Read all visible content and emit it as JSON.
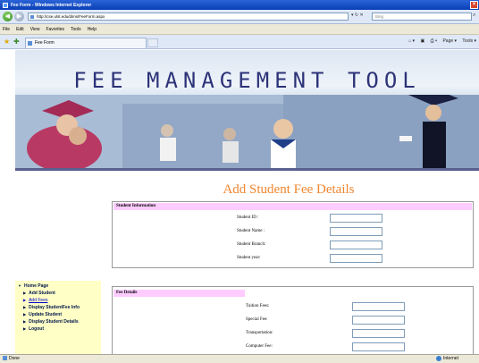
{
  "browser": {
    "window_title": "Fee Form - Windows Internet Explorer",
    "address_url": "http://cse.ulst.edu/dims/FeeForm.aspx",
    "search_placeholder": "Bing",
    "menu": [
      "File",
      "Edit",
      "View",
      "Favorites",
      "Tools",
      "Help"
    ],
    "tab_title": "Fee Form",
    "command_tools": [
      "Page ▾",
      "Tools ▾"
    ],
    "status_text": "Done",
    "status_zone": "Internet"
  },
  "app": {
    "banner_title": "FEE MANAGEMENT TOOL",
    "page_heading": "Add Student Fee Details"
  },
  "sidebar": {
    "home": "Home Page",
    "items": [
      {
        "label": "Add Student"
      },
      {
        "label": "Add Fees"
      },
      {
        "label": "Display StudentFee Info"
      },
      {
        "label": "Update Student"
      },
      {
        "label": "Display Student Details"
      },
      {
        "label": "Logout"
      }
    ]
  },
  "student_info": {
    "header": "Student Information",
    "fields": [
      {
        "label": "Student ID :",
        "value": ""
      },
      {
        "label": "Student Name :",
        "value": ""
      },
      {
        "label": "Student Branch:",
        "value": ""
      },
      {
        "label": "Student year:",
        "value": ""
      }
    ]
  },
  "fee_details": {
    "header": "Fee Details",
    "fields": [
      {
        "label": "Tuition Fees:",
        "value": ""
      },
      {
        "label": "Special Fee:",
        "value": ""
      },
      {
        "label": "Transportation:",
        "value": ""
      },
      {
        "label": "Computer Fee:",
        "value": ""
      }
    ]
  },
  "colors": {
    "title_orange": "#f0862e",
    "banner_title_blue": "#2c3378",
    "panel_header_pink": "#ffccff",
    "menu_bg_yellow": "#ffffc6"
  }
}
